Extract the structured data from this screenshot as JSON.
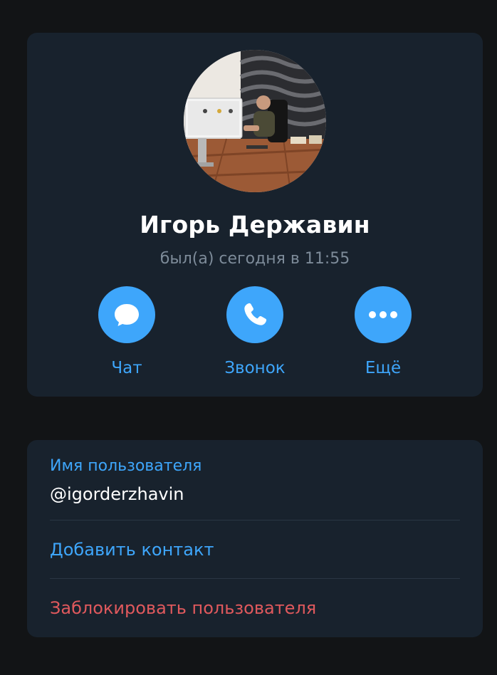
{
  "profile": {
    "name": "Игорь Державин",
    "status": "был(а) сегодня в 11:55"
  },
  "actions": [
    {
      "label": "Чат",
      "icon": "chat-bubble-icon"
    },
    {
      "label": "Звонок",
      "icon": "phone-icon"
    },
    {
      "label": "Ещё",
      "icon": "more-dots-icon"
    }
  ],
  "info": {
    "username_label": "Имя пользователя",
    "username_value": "@igorderzhavin",
    "add_contact": "Добавить контакт",
    "block_user": "Заблокировать пользователя"
  },
  "colors": {
    "background": "#121416",
    "card": "#18222d",
    "accent": "#3ea6fb",
    "danger": "#e0595d",
    "secondary_text": "#7d8b99"
  }
}
